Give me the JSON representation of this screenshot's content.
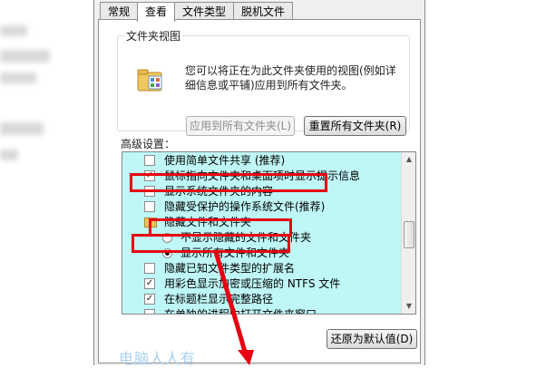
{
  "tabs": [
    {
      "label": "常规",
      "active": false
    },
    {
      "label": "查看",
      "active": true
    },
    {
      "label": "文件类型",
      "active": false
    },
    {
      "label": "脱机文件",
      "active": false
    }
  ],
  "folder_views": {
    "title": "文件夹视图",
    "description": "您可以将正在为此文件夹使用的视图(例如详细信息或平铺)应用到所有文件夹。",
    "apply_button": "应用到所有文件夹(L)",
    "reset_button": "重置所有文件夹(R)"
  },
  "advanced_label": "高级设置：",
  "advanced_items": [
    {
      "kind": "checkbox",
      "checked": false,
      "label": "使用简单文件共享 (推荐)"
    },
    {
      "kind": "checkbox",
      "checked": true,
      "label": "鼠标指向文件夹和桌面项时显示提示信息"
    },
    {
      "kind": "checkbox",
      "checked": false,
      "label": "显示系统文件夹的内容"
    },
    {
      "kind": "checkbox",
      "checked": false,
      "label": "隐藏受保护的操作系统文件(推荐)"
    },
    {
      "kind": "folder",
      "label": "隐藏文件和文件夹"
    },
    {
      "kind": "radio",
      "checked": false,
      "label": "不显示隐藏的文件和文件夹"
    },
    {
      "kind": "radio",
      "checked": true,
      "label": "显示所有文件和文件夹"
    },
    {
      "kind": "checkbox",
      "checked": false,
      "label": "隐藏已知文件类型的扩展名"
    },
    {
      "kind": "checkbox",
      "checked": true,
      "label": "用彩色显示加密或压缩的 NTFS 文件"
    },
    {
      "kind": "checkbox",
      "checked": true,
      "label": "在标题栏显示完整路径"
    },
    {
      "kind": "checkbox",
      "checked": false,
      "label": "在单独的进程中打开文件夹窗口"
    }
  ],
  "restore_button": "还原为默认值(D)",
  "watermark": "电脑人人有",
  "colors": {
    "annotation": "#e60012",
    "list_bg": "#bff6f6"
  },
  "icons": {
    "check": "✓",
    "scroll_up": "▲",
    "scroll_down": "▼"
  }
}
